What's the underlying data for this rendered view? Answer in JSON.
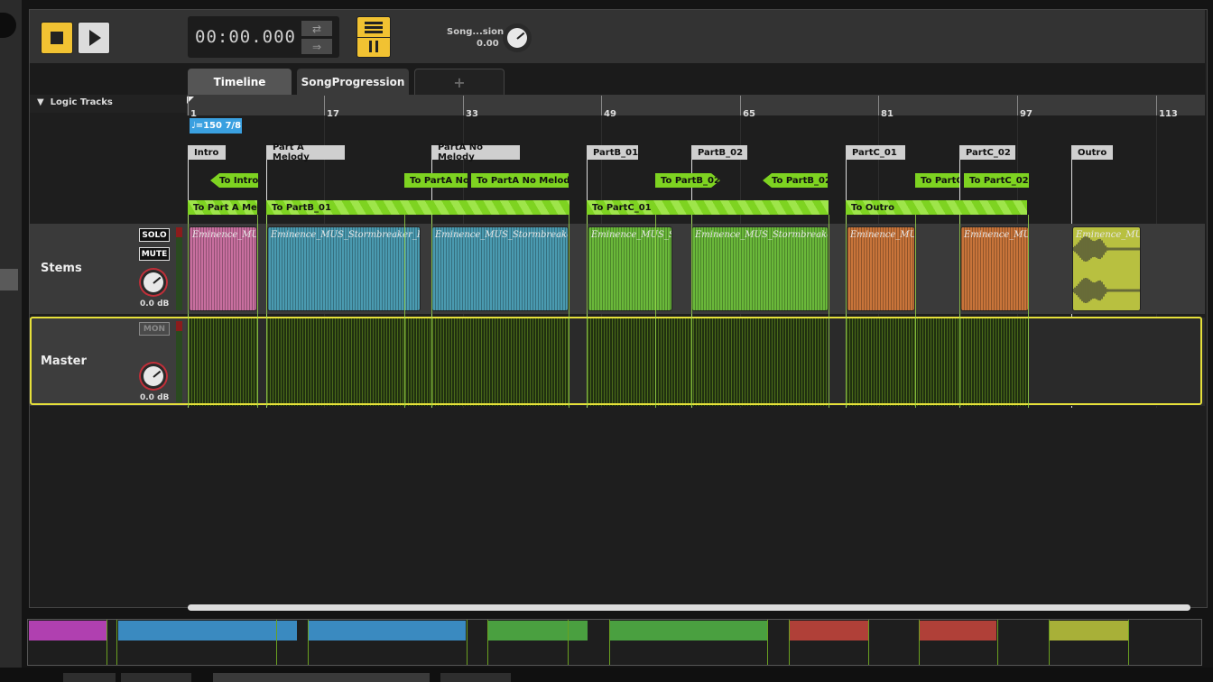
{
  "transport": {
    "time": "00:00.000",
    "song_param_label": "Song...sion",
    "song_param_value": "0.00",
    "stop_icon": "stop-icon",
    "play_icon": "play-icon",
    "loop_icon": "loop-icon",
    "next_icon": "next-arrow-icon"
  },
  "tabs": [
    {
      "label": "Timeline",
      "active": true
    },
    {
      "label": "SongProgression",
      "active": false
    },
    {
      "label": "+",
      "active": false
    }
  ],
  "logic": {
    "label": "Logic Tracks",
    "toggle": "▼"
  },
  "ruler": {
    "ticks": [
      "1",
      "17",
      "33",
      "49",
      "65",
      "81",
      "97",
      "113"
    ]
  },
  "tempo": {
    "label": "=150 7/8",
    "icon": "note-icon"
  },
  "markers": [
    "Intro",
    "Part A Melody",
    "PartA No Melody",
    "PartB_01",
    "PartB_02",
    "PartC_01",
    "PartC_02",
    "Outro"
  ],
  "jumps_row1": [
    "To Intro",
    "To PartA No ",
    "To PartA No Melody",
    "To PartB_02",
    "To PartB_02",
    "To PartC_",
    "To PartC_02"
  ],
  "jumps_row2": [
    "To Part A Melo",
    "To PartB_01",
    "To PartC_01",
    "To Outro"
  ],
  "tracks": {
    "stems": {
      "name": "Stems",
      "solo": "SOLO",
      "mute": "MUTE",
      "db": "0.0 dB"
    },
    "master": {
      "name": "Master",
      "mon": "MON",
      "db": "0.0 dB"
    }
  },
  "clips": [
    {
      "label": "Eminence_MUS_",
      "color": "#c86f9f"
    },
    {
      "label": "Eminence_MUS_Stormbreaker_Part",
      "color": "#4a9ab0"
    },
    {
      "label": "Eminence_MUS_Stormbreaker_",
      "color": "#4a9ab0"
    },
    {
      "label": "Eminence_MUS_Sto",
      "color": "#6ab83a"
    },
    {
      "label": "Eminence_MUS_Stormbreaker_I",
      "color": "#6ab83a"
    },
    {
      "label": "Eminence_MUS",
      "color": "#c8743a"
    },
    {
      "label": "Eminence_MUS",
      "color": "#c8743a"
    },
    {
      "label": "Eminence_MUS",
      "color": "#b8c040"
    }
  ],
  "overview_colors": [
    "#b040b0",
    "#3a8ac0",
    "#3a8ac0",
    "#4aa040",
    "#4aa040",
    "#b04038",
    "#b04038",
    "#a8b038"
  ]
}
